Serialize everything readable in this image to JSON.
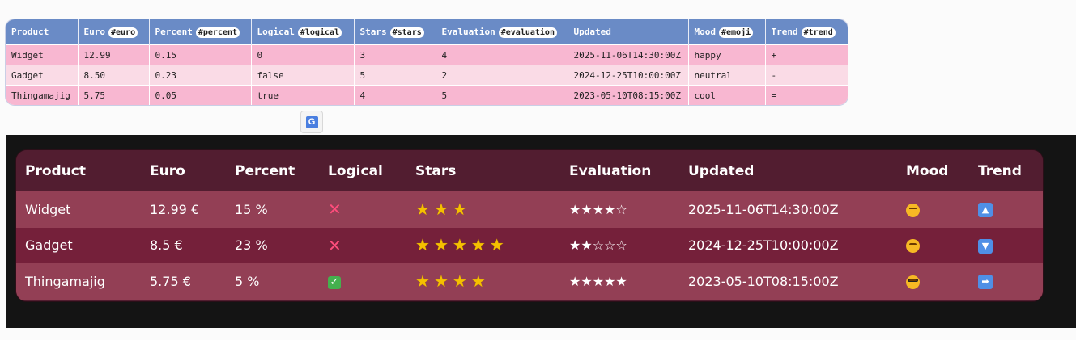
{
  "source_table": {
    "headers": [
      {
        "label": "Product",
        "tag": ""
      },
      {
        "label": "Euro",
        "tag": "#euro"
      },
      {
        "label": "Percent",
        "tag": "#percent"
      },
      {
        "label": "Logical",
        "tag": "#logical"
      },
      {
        "label": "Stars",
        "tag": "#stars"
      },
      {
        "label": "Evaluation",
        "tag": "#evaluation"
      },
      {
        "label": "Updated",
        "tag": ""
      },
      {
        "label": "Mood",
        "tag": "#emoji"
      },
      {
        "label": "Trend",
        "tag": "#trend"
      }
    ],
    "rows": [
      [
        "Widget",
        "12.99",
        "0.15",
        "0",
        "3",
        "4",
        "2025-11-06T14:30:00Z",
        "happy",
        "+"
      ],
      [
        "Gadget",
        "8.50",
        "0.23",
        "false",
        "5",
        "2",
        "2024-12-25T10:00:00Z",
        "neutral",
        "-"
      ],
      [
        "Thingamajig",
        "5.75",
        "0.05",
        "true",
        "4",
        "5",
        "2023-05-10T08:15:00Z",
        "cool",
        "="
      ]
    ]
  },
  "translate_icon": "google-translate-icon",
  "rendered_table": {
    "headers": [
      "Product",
      "Euro",
      "Percent",
      "Logical",
      "Stars",
      "Evaluation",
      "Updated",
      "Mood",
      "Trend"
    ],
    "rows": [
      {
        "product": "Widget",
        "euro": "12.99 €",
        "percent": "15 %",
        "logical": "cross",
        "stars": 3,
        "evaluation": "★★★★☆",
        "updated": "2025-11-06T14:30:00Z",
        "mood": "happy",
        "trend": "up"
      },
      {
        "product": "Gadget",
        "euro": "8.5 €",
        "percent": "23 %",
        "logical": "cross",
        "stars": 5,
        "evaluation": "★★☆☆☆",
        "updated": "2024-12-25T10:00:00Z",
        "mood": "neutral",
        "trend": "down"
      },
      {
        "product": "Thingamajig",
        "euro": "5.75 €",
        "percent": "5 %",
        "logical": "check",
        "stars": 4,
        "evaluation": "★★★★★",
        "updated": "2023-05-10T08:15:00Z",
        "mood": "cool",
        "trend": "right"
      }
    ]
  },
  "colors": {
    "header_blue": "#6a8bc6",
    "row_pink": "#f8b7d1",
    "row_light_pink": "#fadbe6",
    "dark_header": "#521d30",
    "dark_row_a": "#933f55",
    "dark_row_b": "#75203a"
  }
}
